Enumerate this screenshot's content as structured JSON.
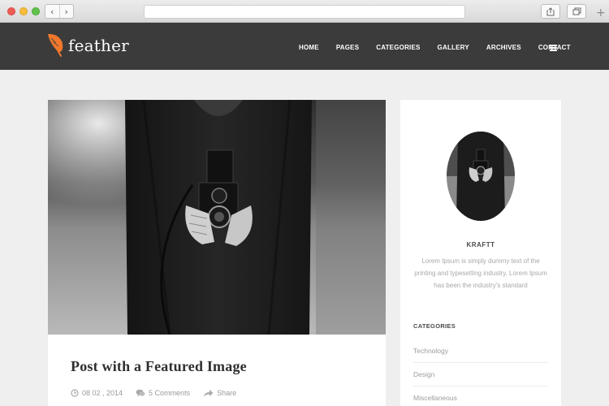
{
  "browser": {
    "back_glyph": "‹",
    "forward_glyph": "›",
    "new_tab_glyph": "+"
  },
  "site": {
    "logo_text": "feather",
    "brand_color": "#f0782c"
  },
  "nav": {
    "items": [
      "HOME",
      "PAGES",
      "CATEGORIES",
      "GALLERY",
      "ARCHIVES",
      "CONTACT"
    ],
    "menu_icon": "hamburger-icon"
  },
  "post": {
    "image_icon": "camera-photo",
    "title": "Post with a Featured Image",
    "date": "08 02 , 2014",
    "comments": "5 Comments",
    "share": "Share"
  },
  "sidebar": {
    "author_name": "KRAFTT",
    "author_bio": "Lorem Ipsum is simply dummy text of the printing and typesetting industry. Lorem Ipsum has been the industry's standard",
    "categories_heading": "CATEGORIES",
    "categories": [
      "Technology",
      "Design",
      "Miscellaneous"
    ]
  }
}
